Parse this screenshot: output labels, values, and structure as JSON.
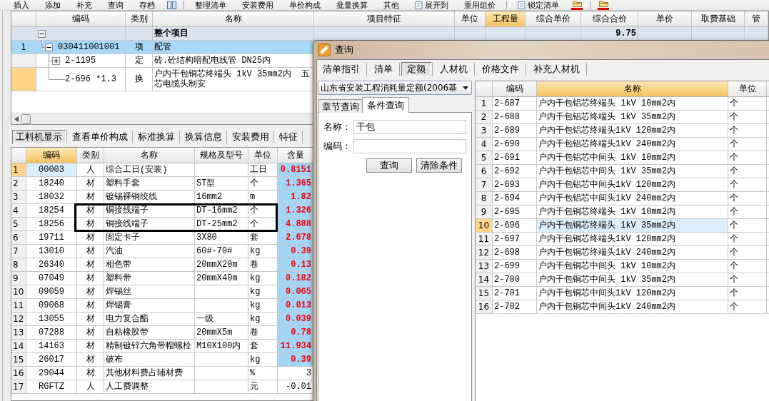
{
  "toolbar": {
    "items": [
      {
        "kind": "text",
        "label": "插入"
      },
      {
        "kind": "text",
        "label": "添加"
      },
      {
        "kind": "text",
        "label": "补充"
      },
      {
        "kind": "text",
        "label": "查询"
      },
      {
        "kind": "text",
        "label": "存档"
      },
      {
        "kind": "icon"
      },
      {
        "kind": "separator"
      },
      {
        "kind": "text",
        "label": "整理清单"
      },
      {
        "kind": "text",
        "label": "安装费用"
      },
      {
        "kind": "text",
        "label": "单价构成"
      },
      {
        "kind": "text",
        "label": "批量换算"
      },
      {
        "kind": "text",
        "label": "其他"
      },
      {
        "kind": "icon_text",
        "label": "展开到"
      },
      {
        "kind": "text",
        "label": "重用组价"
      },
      {
        "kind": "separator"
      },
      {
        "kind": "icon_text",
        "label": "锁定清单"
      },
      {
        "kind": "icon",
        "color": "#e00000"
      },
      {
        "kind": "separator"
      },
      {
        "kind": "icon",
        "color": "#e00000"
      }
    ]
  },
  "bill_grid": {
    "columns": [
      {
        "label": "编码",
        "highlighted": false
      },
      {
        "label": "类别",
        "highlighted": false
      },
      {
        "label": "名称",
        "highlighted": false
      },
      {
        "label": "项目特征",
        "highlighted": false
      },
      {
        "label": "单位",
        "highlighted": false
      },
      {
        "label": "工程量",
        "highlighted": true
      },
      {
        "label": "综合单价",
        "highlighted": false
      },
      {
        "label": "综合合价",
        "highlighted": false
      },
      {
        "label": "单价",
        "highlighted": false
      },
      {
        "label": "取费基础",
        "highlighted": false
      },
      {
        "label": "管",
        "highlighted": false
      }
    ],
    "rows": [
      {
        "kind": "summary",
        "name": "整个项目",
        "total": "9.75",
        "expanded": true,
        "selected": false,
        "current": false,
        "children": [
          {
            "kind": "item",
            "no": "1",
            "code": "030411001001",
            "type": "项",
            "name": "配管",
            "expanded": true,
            "selected": true,
            "current": false,
            "children": [
              {
                "kind": "item",
                "code": "2-1195",
                "type": "定",
                "name": "砖.砼结构暗配电线管 DN25内",
                "expanded": false,
                "selected": false,
                "current": false
              },
              {
                "kind": "item",
                "code": "2-696 *1.3",
                "type": "换",
                "name": "户内干包铜芯终端头 1kV 35mm2内  五芯电缆头制安",
                "selected": false,
                "current": true
              }
            ]
          }
        ]
      }
    ]
  },
  "detail_tabs": [
    {
      "label": "工料机显示",
      "selected": true
    },
    {
      "label": "查看单价构成",
      "selected": false
    },
    {
      "label": "标准换算",
      "selected": false
    },
    {
      "label": "换算信息",
      "selected": false
    },
    {
      "label": "安装费用",
      "selected": false
    },
    {
      "label": "特征",
      "selected": false
    }
  ],
  "resource_grid": {
    "columns": [
      {
        "label": "编码",
        "highlighted": true
      },
      {
        "label": "类别",
        "highlighted": false
      },
      {
        "label": "名称",
        "highlighted": false
      },
      {
        "label": "规格及型号",
        "highlighted": false
      },
      {
        "label": "单位",
        "highlighted": false
      },
      {
        "label": "含量",
        "highlighted": false
      }
    ],
    "rows": [
      {
        "no": "1",
        "code": "00003",
        "type": "人",
        "name": "综合工日(安装)",
        "unit": "工日",
        "amount": "0.8151",
        "modified": true,
        "current": true,
        "outlined": false
      },
      {
        "no": "2",
        "code": "18240",
        "type": "材",
        "name": "塑料手套",
        "spec": "ST型",
        "unit": "个",
        "amount": "1.365",
        "modified": true,
        "current": false,
        "outlined": false
      },
      {
        "no": "3",
        "code": "18032",
        "type": "材",
        "name": "镀锡裸铜绞线",
        "spec": "16mm2",
        "unit": "m",
        "amount": "1.82",
        "modified": true,
        "current": false,
        "outlined": false
      },
      {
        "no": "4",
        "code": "18254",
        "type": "材",
        "name": "铜接线端子",
        "spec": "DT-16mm2",
        "unit": "个",
        "amount": "1.326",
        "modified": true,
        "current": false,
        "outlined": true
      },
      {
        "no": "5",
        "code": "18256",
        "type": "材",
        "name": "铜接线端子",
        "spec": "DT-25mm2",
        "unit": "个",
        "amount": "4.888",
        "modified": true,
        "current": false,
        "outlined": true
      },
      {
        "no": "6",
        "code": "19711",
        "type": "材",
        "name": "固定卡子",
        "spec": "3X80",
        "unit": "套",
        "amount": "2.678",
        "modified": true,
        "current": false,
        "outlined": false
      },
      {
        "no": "7",
        "code": "13010",
        "type": "材",
        "name": "汽油",
        "spec": "60#-70#",
        "unit": "kg",
        "amount": "0.39",
        "modified": true,
        "current": false,
        "outlined": false
      },
      {
        "no": "8",
        "code": "26340",
        "type": "材",
        "name": "相色带",
        "spec": "20mmX20m",
        "unit": "卷",
        "amount": "0.13",
        "modified": true,
        "current": false,
        "outlined": false
      },
      {
        "no": "9",
        "code": "07049",
        "type": "材",
        "name": "塑料带",
        "spec": "20mmX40m",
        "unit": "kg",
        "amount": "0.182",
        "modified": true,
        "current": false,
        "outlined": false
      },
      {
        "no": "10",
        "code": "09059",
        "type": "材",
        "name": "焊锡丝",
        "unit": "kg",
        "amount": "0.065",
        "modified": true,
        "current": false,
        "outlined": false
      },
      {
        "no": "11",
        "code": "09068",
        "type": "材",
        "name": "焊锡膏",
        "unit": "kg",
        "amount": "0.013",
        "modified": true,
        "current": false,
        "outlined": false
      },
      {
        "no": "12",
        "code": "13055",
        "type": "材",
        "name": "电力复合酯",
        "spec": "一级",
        "unit": "kg",
        "amount": "0.039",
        "modified": true,
        "current": false,
        "outlined": false
      },
      {
        "no": "13",
        "code": "07288",
        "type": "材",
        "name": "自粘橡胶带",
        "spec": "20mmX5m",
        "unit": "卷",
        "amount": "0.78",
        "modified": true,
        "current": false,
        "outlined": false
      },
      {
        "no": "14",
        "code": "14163",
        "type": "材",
        "name": "精制镀锌六角带帽螺栓",
        "spec": "M10X100内",
        "unit": "套",
        "amount": "11.934",
        "modified": true,
        "current": false,
        "outlined": false
      },
      {
        "no": "15",
        "code": "26017",
        "type": "材",
        "name": "破布",
        "unit": "kg",
        "amount": "0.39",
        "modified": true,
        "current": false,
        "outlined": false
      },
      {
        "no": "16",
        "code": "29044",
        "type": "材",
        "name": "其他材料费占辅材费",
        "unit": "%",
        "amount": "3",
        "modified": false,
        "current": false,
        "outlined": false
      },
      {
        "no": "17",
        "code": "RGFTZ",
        "type": "人",
        "name": "人工费调整",
        "unit": "元",
        "amount": "-0.01",
        "modified": false,
        "current": false,
        "outlined": false
      }
    ]
  },
  "query_dialog": {
    "title": "查询",
    "tabs": [
      {
        "label": "清单指引",
        "selected": false
      },
      {
        "label": "清单",
        "selected": false
      },
      {
        "label": "定额",
        "selected": true
      },
      {
        "label": "人材机",
        "selected": false
      },
      {
        "label": "价格文件",
        "selected": false
      },
      {
        "label": "补充人材机",
        "selected": false
      }
    ],
    "library": {
      "value": "山东省安装工程消耗量定额(2006基"
    },
    "search_tabs": [
      {
        "label": "章节查询",
        "selected": false
      },
      {
        "label": "条件查询",
        "selected": true
      }
    ],
    "fields": [
      {
        "label": "名称：",
        "value": "干包"
      },
      {
        "label": "编码："
      }
    ],
    "buttons": [
      "查询",
      "清除条件"
    ],
    "results": {
      "columns": [
        {
          "label": "编码",
          "highlighted": false
        },
        {
          "label": "名称",
          "highlighted": true
        },
        {
          "label": "单位",
          "highlighted": false
        }
      ],
      "rows": [
        {
          "no": "1",
          "code": "2-687",
          "name": "户内干包铝芯终端头 1kV 10mm2内",
          "unit": "个",
          "current": false
        },
        {
          "no": "2",
          "code": "2-688",
          "name": "户内干包铝芯终端头 1kV 35mm2内",
          "unit": "个",
          "current": false
        },
        {
          "no": "3",
          "code": "2-689",
          "name": "户内干包铝芯终端头1kV 120mm2内",
          "unit": "个",
          "current": false
        },
        {
          "no": "4",
          "code": "2-690",
          "name": "户内干包铝芯终端头1kV 240mm2内",
          "unit": "个",
          "current": false
        },
        {
          "no": "5",
          "code": "2-691",
          "name": "户内干包铝芯中间头 1kV 10mm2内",
          "unit": "个",
          "current": false
        },
        {
          "no": "6",
          "code": "2-692",
          "name": "户内干包铝芯中间头 1kV 35mm2内",
          "unit": "个",
          "current": false
        },
        {
          "no": "7",
          "code": "2-693",
          "name": "户内干包铝芯中间头1kV 120mm2内",
          "unit": "个",
          "current": false
        },
        {
          "no": "8",
          "code": "2-694",
          "name": "户内干包铝芯中间头1kV 240mm2内",
          "unit": "个",
          "current": false
        },
        {
          "no": "9",
          "code": "2-695",
          "name": "户内干包铜芯终端头 1kV 10mm2内",
          "unit": "个",
          "current": false
        },
        {
          "no": "10",
          "code": "2-696",
          "name": "户内干包铜芯终端头 1kV 35mm2内",
          "unit": "个",
          "current": true
        },
        {
          "no": "11",
          "code": "2-697",
          "name": "户内干包铜芯终端头1kV 120mm2内",
          "unit": "个",
          "current": false
        },
        {
          "no": "12",
          "code": "2-698",
          "name": "户内干包铜芯终端头1kV 240mm2内",
          "unit": "个",
          "current": false
        },
        {
          "no": "13",
          "code": "2-699",
          "name": "户内干包铜芯中间头 1kV 10mm2内",
          "unit": "个",
          "current": false
        },
        {
          "no": "14",
          "code": "2-700",
          "name": "户内干包铜芯中间头 1kV 35mm2内",
          "unit": "个",
          "current": false
        },
        {
          "no": "15",
          "code": "2-701",
          "name": "户内干包铜芯中间头1kV 120mm2内",
          "unit": "个",
          "current": false
        },
        {
          "no": "16",
          "code": "2-702",
          "name": "户内干包铜芯中间头1kV 240mm2内",
          "unit": "个",
          "current": false
        }
      ]
    }
  }
}
